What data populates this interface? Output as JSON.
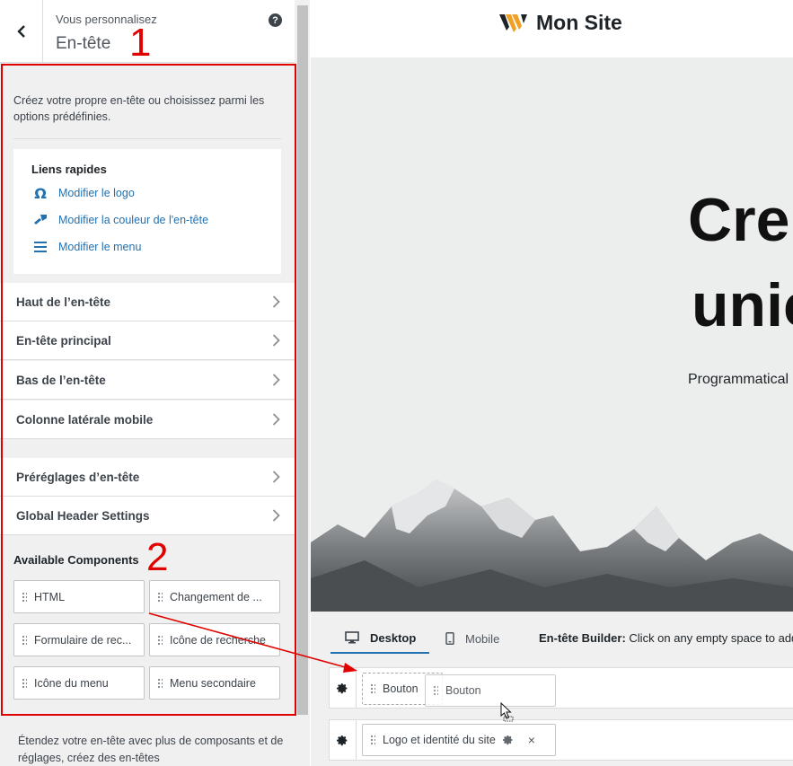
{
  "sidebar": {
    "subtitle": "Vous personnalisez",
    "title": "En-tête",
    "help": "?",
    "description": "Créez votre propre en-tête ou choisissez parmi les options prédéfinies.",
    "quick_links": {
      "title": "Liens rapides",
      "items": [
        {
          "label": "Modifier le logo",
          "icon": "omega-icon"
        },
        {
          "label": "Modifier la couleur de l'en-tête",
          "icon": "paint-brush-icon"
        },
        {
          "label": "Modifier le menu",
          "icon": "menu-lines-icon"
        }
      ]
    },
    "sections": [
      "Haut de l’en-tête",
      "En-tête principal",
      "Bas de l’en-tête",
      "Colonne latérale mobile"
    ],
    "sections2": [
      "Préréglages d’en-tête",
      "Global Header Settings"
    ],
    "available_components": {
      "title": "Available Components",
      "items": [
        "HTML",
        "Changement de ...",
        "Formulaire de rec...",
        "Icône de recherche",
        "Icône du menu",
        "Menu secondaire"
      ]
    },
    "extend_text": "Étendez votre en-tête avec plus de composants et de réglages, créez des en-têtes"
  },
  "annotations": {
    "one": "1",
    "two": "2"
  },
  "preview": {
    "site_title": "Mon Site",
    "hero_line1": "Cre",
    "hero_line2": "unic",
    "hero_sub": "Programmatical",
    "builder": {
      "tab_desktop": "Desktop",
      "tab_mobile": "Mobile",
      "hint_bold": "En-tête Builder:",
      "hint": " Click on any empty space to add",
      "row1": {
        "ghost_chip": "Bouton",
        "drag_chip": "Bouton"
      },
      "row2": {
        "chip": "Logo et identité du site",
        "close": "×"
      }
    }
  },
  "colors": {
    "accent": "#2271b1",
    "annotation": "#e00000",
    "logo_orange": "#f0a024"
  }
}
